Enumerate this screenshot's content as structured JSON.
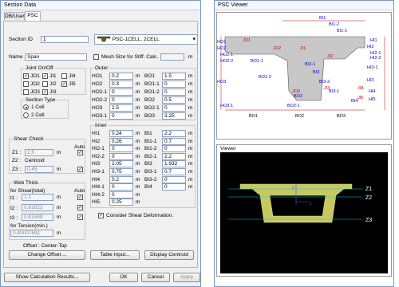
{
  "section_data": {
    "title": "Section Data",
    "tabs": [
      "DB/User",
      "PSC"
    ],
    "section_id_label": "Section ID",
    "section_id": "1",
    "section_type_value": "PSC-1CELL, 2CELL",
    "name_label": "Name",
    "name": "Span",
    "mesh_label": "Mesh Size for Stiff. Calc.",
    "mesh_unit": "m",
    "joint_group": "Joint On/Off",
    "joints": [
      {
        "label": "JO1",
        "checked": true
      },
      {
        "label": "JI1",
        "checked": true
      },
      {
        "label": "JI4",
        "checked": false
      },
      {
        "label": "JO2",
        "checked": false
      },
      {
        "label": "JI2",
        "checked": false
      },
      {
        "label": "JI5",
        "checked": true
      },
      {
        "label": "JO3",
        "checked": false
      },
      {
        "label": "JI3",
        "checked": true
      }
    ],
    "section_type_group": "Section Type",
    "cells": [
      {
        "label": "1 Cell",
        "selected": true
      },
      {
        "label": "2 Cell",
        "selected": false
      }
    ],
    "shear_group": "Shear Check",
    "auto_label": "Auto",
    "shear": [
      {
        "label": "Z1 :",
        "value": "2.5",
        "unit": "m",
        "auto": true,
        "type": "input"
      },
      {
        "label": "Z2 :",
        "value": "Centroid",
        "unit": "",
        "auto": false,
        "type": "text"
      },
      {
        "label": "Z3 :",
        "value": "0.45",
        "unit": "m",
        "auto": true,
        "type": "input"
      }
    ],
    "web_group": "Web Thick.",
    "web_shear_label": "for Shear(total)",
    "web": [
      {
        "label": "t1 :",
        "value": "1.1",
        "unit": "m",
        "auto": true
      },
      {
        "label": "t2 :",
        "value": "0.81623",
        "unit": "m",
        "auto": true
      },
      {
        "label": "t3 :",
        "value": "0.81599",
        "unit": "m",
        "auto": true
      }
    ],
    "torsion_label": "for Torsion(min.)",
    "torsion_value": "0.40007691",
    "torsion_unit": "m",
    "outer_group": "Outer",
    "outer_left": [
      {
        "label": "HO1",
        "value": "0.2"
      },
      {
        "label": "HO2",
        "value": "0.3"
      },
      {
        "label": "HO2-1",
        "value": "0"
      },
      {
        "label": "HO2-2",
        "value": "0"
      },
      {
        "label": "HO3",
        "value": "2.5"
      },
      {
        "label": "HO3-1",
        "value": "0"
      }
    ],
    "outer_right": [
      {
        "label": "BO1",
        "value": "1.5"
      },
      {
        "label": "BO1-1",
        "value": "0"
      },
      {
        "label": "BO1-2",
        "value": "0"
      },
      {
        "label": "BO2",
        "value": "0.5"
      },
      {
        "label": "BO2-1",
        "value": "0"
      },
      {
        "label": "BO3",
        "value": "3.25"
      }
    ],
    "inner_group": "Inner",
    "inner_left": [
      {
        "label": "HI1",
        "value": "0.24"
      },
      {
        "label": "HI2",
        "value": "0.26"
      },
      {
        "label": "HI2-1",
        "value": "0"
      },
      {
        "label": "HI2-2",
        "value": "0"
      },
      {
        "label": "HI3",
        "value": "2.05"
      },
      {
        "label": "HI3-1",
        "value": "0.75"
      },
      {
        "label": "HI4",
        "value": "0.2"
      },
      {
        "label": "HI4-1",
        "value": "0"
      },
      {
        "label": "HI4-2",
        "value": "0"
      },
      {
        "label": "HI5",
        "value": "0.25"
      }
    ],
    "inner_right": [
      {
        "label": "BI1",
        "value": "2.2"
      },
      {
        "label": "BI1-1",
        "value": "0.7"
      },
      {
        "label": "BI1-2",
        "value": "0"
      },
      {
        "label": "BI2-1",
        "value": "2.2"
      },
      {
        "label": "BI3",
        "value": "1.932"
      },
      {
        "label": "BI3-1",
        "value": "0.7"
      },
      {
        "label": "BI3-2",
        "value": "0"
      },
      {
        "label": "BI4",
        "value": "0"
      }
    ],
    "unit_m": "m",
    "consider_shear": "Consider Shear Deformation.",
    "offset_label": "Offset : Center-Top",
    "buttons": [
      "Change Offset ...",
      "Table Input...",
      "Display Centroid"
    ],
    "bottom_buttons": [
      "Show Calculation Results...",
      "OK",
      "Cancel",
      "Apply"
    ]
  },
  "psc_viewer": {
    "title": "PSC Viewer",
    "dims_top": [
      "BI1",
      "BI1-2",
      "BI1-1",
      "BI3",
      "BI3-2",
      "BI3-1",
      "BI2-1",
      "BI4"
    ],
    "dims_left": [
      "HO1",
      "HO2",
      "HO2-1",
      "HO2-2",
      "HO3",
      "HO3-1"
    ],
    "dims_right": [
      "HI1",
      "HI2",
      "HI2-1",
      "HI2-2",
      "HI3-1",
      "HI3",
      "HI4",
      "HI5"
    ],
    "dims_bottom": [
      "BO1",
      "BO2",
      "BO3"
    ],
    "inner_labels": [
      "BO1-1",
      "BO1-2",
      "BO2-1",
      "BO2",
      "JO1",
      "JO2",
      "JO3",
      "JI1",
      "JI2",
      "JI3",
      "JI4",
      "JI5"
    ],
    "bottom_labels": [
      "BO1-1",
      "BO1-2",
      "BO2-1",
      "BO2",
      "BO3"
    ],
    "viewer_label": "Viewer",
    "z_labels": [
      "Z1",
      "Z2",
      "Z3"
    ],
    "axis_labels": [
      "z",
      "y"
    ],
    "colors": {
      "section_fill": "#c8c8c8",
      "viewer_bg": "#000000",
      "section_yellow": "#c8c860",
      "dim_red": "#cc0000",
      "dim_blue": "#0000cc",
      "z_line": "#00c8ff"
    }
  }
}
